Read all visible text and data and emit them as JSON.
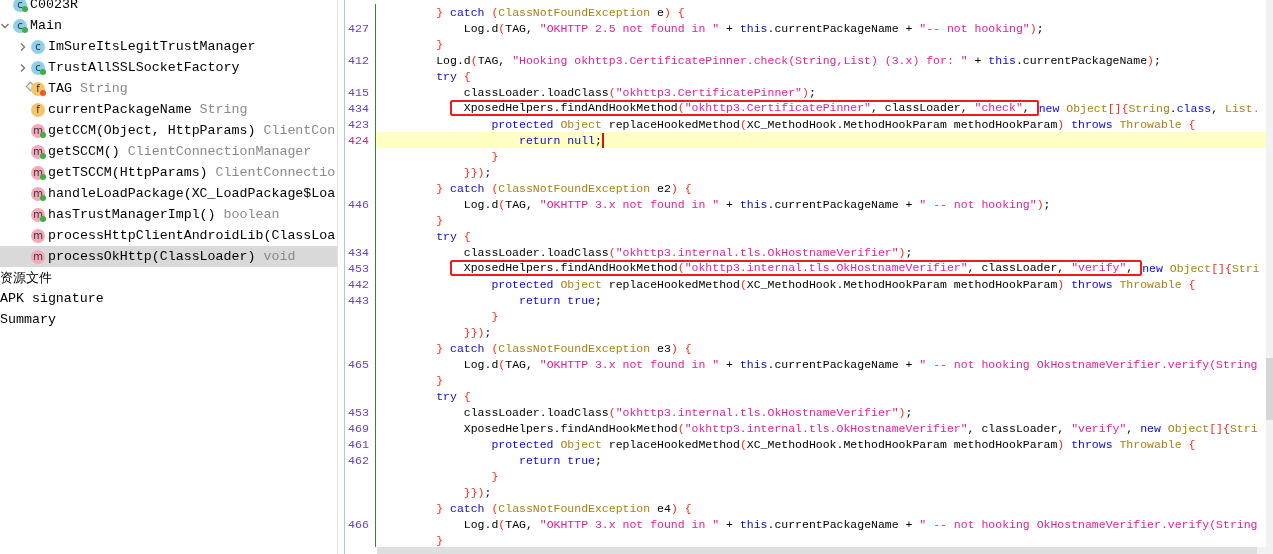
{
  "tree": {
    "items": [
      {
        "children": [
          {
            "label": "C0023R",
            "kind": "class",
            "icon": "c",
            "color": "#3cb043",
            "selected": false
          },
          {
            "label": "Main",
            "kind": "class",
            "icon": "c",
            "color": "#3cb043",
            "expanded": true,
            "selected": false,
            "children": [
              {
                "label": "ImSureItsLegitTrustManager",
                "kind": "class",
                "icon": "c",
                "expanded": false,
                "selected": false
              },
              {
                "label": "TrustAllSSLSocketFactory",
                "kind": "class",
                "icon": "c",
                "color": "#3cb043",
                "expanded": false,
                "selected": false
              },
              {
                "label": "TAG",
                "type": "String",
                "kind": "field",
                "icon": "f",
                "color": "#f05a24",
                "static": true,
                "selected": false
              },
              {
                "label": "currentPackageName",
                "type": "String",
                "kind": "field",
                "icon": "f",
                "selected": false
              },
              {
                "label": "getCCM(Object, HttpParams)",
                "type": "ClientCon",
                "kind": "method",
                "icon": "m",
                "color": "#3cb043",
                "selected": false
              },
              {
                "label": "getSCCM()",
                "type": "ClientConnectionManager",
                "kind": "method",
                "icon": "m",
                "color": "#3cb043",
                "selected": false
              },
              {
                "label": "getTSCCM(HttpParams)",
                "type": "ClientConnectio",
                "kind": "method",
                "icon": "m",
                "color": "#3cb043",
                "selected": false
              },
              {
                "label": "handleLoadPackage(XC_LoadPackage$Loa",
                "kind": "method",
                "icon": "m",
                "color": "#3cb043",
                "selected": false
              },
              {
                "label": "hasTrustManagerImpl()",
                "type": "boolean",
                "kind": "method",
                "icon": "m",
                "color": "#3cb043",
                "selected": false
              },
              {
                "label": "processHttpClientAndroidLib(ClassLoa",
                "kind": "method",
                "icon": "m",
                "selected": false
              },
              {
                "label": "processOkHttp(ClassLoader)",
                "type": "void",
                "kind": "method",
                "icon": "m",
                "selected": true
              }
            ]
          }
        ]
      },
      {
        "label": "资源文件",
        "selected": false
      },
      {
        "label": "APK signature",
        "selected": false
      },
      {
        "label": "Summary",
        "selected": false
      }
    ]
  },
  "editor": {
    "lines": [
      {
        "segments": [
          {
            "kind": "b",
            "text": "        }"
          },
          {
            "kind": "k",
            "text": " catch "
          },
          {
            "kind": "b",
            "text": "("
          },
          {
            "kind": "t",
            "text": "ClassNotFoundException"
          },
          {
            "kind": "p",
            "text": " e"
          },
          {
            "kind": "b",
            "text": ") {"
          }
        ]
      },
      {
        "number": "427",
        "segments": [
          {
            "kind": "p",
            "text": "            Log.d"
          },
          {
            "kind": "b",
            "text": "("
          },
          {
            "kind": "p",
            "text": "TAG, "
          },
          {
            "kind": "s",
            "text": "\"OKHTTP 2.5 not found in \""
          },
          {
            "kind": "p",
            "text": " + "
          },
          {
            "kind": "k",
            "text": "this"
          },
          {
            "kind": "p",
            "text": ".currentPackageName + "
          },
          {
            "kind": "s",
            "text": "\"-- not hooking\""
          },
          {
            "kind": "b",
            "text": ")"
          },
          {
            "kind": "p",
            "text": ";"
          }
        ]
      },
      {
        "segments": [
          {
            "kind": "b",
            "text": "        }"
          }
        ]
      },
      {
        "number": "412",
        "segments": [
          {
            "kind": "p",
            "text": "        Log.d"
          },
          {
            "kind": "b",
            "text": "("
          },
          {
            "kind": "p",
            "text": "TAG, "
          },
          {
            "kind": "s",
            "text": "\"Hooking okhttp3.CertificatePinner.check(String,List) (3.x) for: \""
          },
          {
            "kind": "p",
            "text": " + "
          },
          {
            "kind": "k",
            "text": "this"
          },
          {
            "kind": "p",
            "text": ".currentPackageName"
          },
          {
            "kind": "b",
            "text": ")"
          },
          {
            "kind": "p",
            "text": ";"
          }
        ]
      },
      {
        "segments": [
          {
            "kind": "k",
            "text": "        try "
          },
          {
            "kind": "b",
            "text": "{"
          }
        ]
      },
      {
        "number": "415",
        "segments": [
          {
            "kind": "p",
            "text": "            classLoader.loadClass"
          },
          {
            "kind": "b",
            "text": "("
          },
          {
            "kind": "s",
            "text": "\"okhttp3.CertificatePinner\""
          },
          {
            "kind": "b",
            "text": ")"
          },
          {
            "kind": "p",
            "text": ";"
          }
        ]
      },
      {
        "number": "434",
        "boxed": [
          {
            "kind": "p",
            "text": "            XposedHelpers.findAndHookMethod"
          },
          {
            "kind": "b",
            "text": "("
          },
          {
            "kind": "s",
            "text": "\"okhttp3.CertificatePinner\""
          },
          {
            "kind": "p",
            "text": ", classLoader, "
          },
          {
            "kind": "s",
            "text": "\"check\""
          },
          {
            "kind": "p",
            "text": ", "
          }
        ],
        "segments": [
          {
            "kind": "k",
            "text": "new "
          },
          {
            "kind": "t",
            "text": "Object"
          },
          {
            "kind": "b",
            "text": "[]{"
          },
          {
            "kind": "t",
            "text": "String"
          },
          {
            "kind": "p",
            "text": "."
          },
          {
            "kind": "k",
            "text": "class"
          },
          {
            "kind": "p",
            "text": ", "
          },
          {
            "kind": "t",
            "text": "List."
          }
        ]
      },
      {
        "number": "423",
        "segments": [
          {
            "kind": "k",
            "text": "                protected "
          },
          {
            "kind": "t",
            "text": "Object"
          },
          {
            "kind": "p",
            "text": " replaceHookedMethod"
          },
          {
            "kind": "b",
            "text": "("
          },
          {
            "kind": "p",
            "text": "XC_MethodHook.MethodHookParam methodHookParam"
          },
          {
            "kind": "b",
            "text": ")"
          },
          {
            "kind": "k",
            "text": " throws "
          },
          {
            "kind": "t",
            "text": "Throwable"
          },
          {
            "kind": "b",
            "text": " {"
          }
        ]
      },
      {
        "number": "424",
        "current": true,
        "segments": [
          {
            "kind": "k",
            "text": "                    return null"
          },
          {
            "kind": "p",
            "text": ";"
          }
        ]
      },
      {
        "segments": [
          {
            "kind": "b",
            "text": "                }"
          }
        ]
      },
      {
        "segments": [
          {
            "kind": "b",
            "text": "            }})"
          },
          {
            "kind": "p",
            "text": ";"
          }
        ]
      },
      {
        "segments": [
          {
            "kind": "b",
            "text": "        }"
          },
          {
            "kind": "k",
            "text": " catch "
          },
          {
            "kind": "b",
            "text": "("
          },
          {
            "kind": "t",
            "text": "ClassNotFoundException"
          },
          {
            "kind": "p",
            "text": " e2"
          },
          {
            "kind": "b",
            "text": ") {"
          }
        ]
      },
      {
        "number": "446",
        "segments": [
          {
            "kind": "p",
            "text": "            Log.d"
          },
          {
            "kind": "b",
            "text": "("
          },
          {
            "kind": "p",
            "text": "TAG, "
          },
          {
            "kind": "s",
            "text": "\"OKHTTP 3.x not found in \""
          },
          {
            "kind": "p",
            "text": " + "
          },
          {
            "kind": "k",
            "text": "this"
          },
          {
            "kind": "p",
            "text": ".currentPackageName + "
          },
          {
            "kind": "s",
            "text": "\" -- not hooking\""
          },
          {
            "kind": "b",
            "text": ")"
          },
          {
            "kind": "p",
            "text": ";"
          }
        ]
      },
      {
        "segments": [
          {
            "kind": "b",
            "text": "        }"
          }
        ]
      },
      {
        "segments": [
          {
            "kind": "k",
            "text": "        try "
          },
          {
            "kind": "b",
            "text": "{"
          }
        ]
      },
      {
        "number": "434",
        "segments": [
          {
            "kind": "p",
            "text": "            classLoader.loadClass"
          },
          {
            "kind": "b",
            "text": "("
          },
          {
            "kind": "s",
            "text": "\"okhttp3.internal.tls.OkHostnameVerifier\""
          },
          {
            "kind": "b",
            "text": ")"
          },
          {
            "kind": "p",
            "text": ";"
          }
        ]
      },
      {
        "number": "453",
        "boxed": [
          {
            "kind": "p",
            "text": "            XposedHelpers.findAndHookMethod"
          },
          {
            "kind": "b",
            "text": "("
          },
          {
            "kind": "s",
            "text": "\"okhttp3.internal.tls.OkHostnameVerifier\""
          },
          {
            "kind": "p",
            "text": ", classLoader, "
          },
          {
            "kind": "s",
            "text": "\"verify\""
          },
          {
            "kind": "p",
            "text": ", "
          }
        ],
        "segments": [
          {
            "kind": "k",
            "text": "new "
          },
          {
            "kind": "t",
            "text": "Object"
          },
          {
            "kind": "b",
            "text": "[]{"
          },
          {
            "kind": "t",
            "text": "Stri"
          }
        ]
      },
      {
        "number": "442",
        "segments": [
          {
            "kind": "k",
            "text": "                protected "
          },
          {
            "kind": "t",
            "text": "Object"
          },
          {
            "kind": "p",
            "text": " replaceHookedMethod"
          },
          {
            "kind": "b",
            "text": "("
          },
          {
            "kind": "p",
            "text": "XC_MethodHook.MethodHookParam methodHookParam"
          },
          {
            "kind": "b",
            "text": ")"
          },
          {
            "kind": "k",
            "text": " throws "
          },
          {
            "kind": "t",
            "text": "Throwable"
          },
          {
            "kind": "b",
            "text": " {"
          }
        ]
      },
      {
        "number": "443",
        "segments": [
          {
            "kind": "k",
            "text": "                    return true"
          },
          {
            "kind": "p",
            "text": ";"
          }
        ]
      },
      {
        "segments": [
          {
            "kind": "b",
            "text": "                }"
          }
        ]
      },
      {
        "segments": [
          {
            "kind": "b",
            "text": "            }})"
          },
          {
            "kind": "p",
            "text": ";"
          }
        ]
      },
      {
        "segments": [
          {
            "kind": "b",
            "text": "        }"
          },
          {
            "kind": "k",
            "text": " catch "
          },
          {
            "kind": "b",
            "text": "("
          },
          {
            "kind": "t",
            "text": "ClassNotFoundException"
          },
          {
            "kind": "p",
            "text": " e3"
          },
          {
            "kind": "b",
            "text": ") {"
          }
        ]
      },
      {
        "number": "465",
        "segments": [
          {
            "kind": "p",
            "text": "            Log.d"
          },
          {
            "kind": "b",
            "text": "("
          },
          {
            "kind": "p",
            "text": "TAG, "
          },
          {
            "kind": "s",
            "text": "\"OKHTTP 3.x not found in \""
          },
          {
            "kind": "p",
            "text": " + "
          },
          {
            "kind": "k",
            "text": "this"
          },
          {
            "kind": "p",
            "text": ".currentPackageName + "
          },
          {
            "kind": "s",
            "text": "\" -- not hooking OkHostnameVerifier.verify(String"
          }
        ]
      },
      {
        "segments": [
          {
            "kind": "b",
            "text": "        }"
          }
        ]
      },
      {
        "segments": [
          {
            "kind": "k",
            "text": "        try "
          },
          {
            "kind": "b",
            "text": "{"
          }
        ]
      },
      {
        "number": "453",
        "segments": [
          {
            "kind": "p",
            "text": "            classLoader.loadClass"
          },
          {
            "kind": "b",
            "text": "("
          },
          {
            "kind": "s",
            "text": "\"okhttp3.internal.tls.OkHostnameVerifier\""
          },
          {
            "kind": "b",
            "text": ")"
          },
          {
            "kind": "p",
            "text": ";"
          }
        ]
      },
      {
        "number": "469",
        "segments": [
          {
            "kind": "p",
            "text": "            XposedHelpers.findAndHookMethod"
          },
          {
            "kind": "b",
            "text": "("
          },
          {
            "kind": "s",
            "text": "\"okhttp3.internal.tls.OkHostnameVerifier\""
          },
          {
            "kind": "p",
            "text": ", classLoader, "
          },
          {
            "kind": "s",
            "text": "\"verify\""
          },
          {
            "kind": "p",
            "text": ", "
          },
          {
            "kind": "k",
            "text": "new "
          },
          {
            "kind": "t",
            "text": "Object"
          },
          {
            "kind": "b",
            "text": "[]{"
          },
          {
            "kind": "t",
            "text": "Stri"
          }
        ]
      },
      {
        "number": "461",
        "segments": [
          {
            "kind": "k",
            "text": "                protected "
          },
          {
            "kind": "t",
            "text": "Object"
          },
          {
            "kind": "p",
            "text": " replaceHookedMethod"
          },
          {
            "kind": "b",
            "text": "("
          },
          {
            "kind": "p",
            "text": "XC_MethodHook.MethodHookParam methodHookParam"
          },
          {
            "kind": "b",
            "text": ")"
          },
          {
            "kind": "k",
            "text": " throws "
          },
          {
            "kind": "t",
            "text": "Throwable"
          },
          {
            "kind": "b",
            "text": " {"
          }
        ]
      },
      {
        "number": "462",
        "segments": [
          {
            "kind": "k",
            "text": "                    return true"
          },
          {
            "kind": "p",
            "text": ";"
          }
        ]
      },
      {
        "segments": [
          {
            "kind": "b",
            "text": "                }"
          }
        ]
      },
      {
        "segments": [
          {
            "kind": "b",
            "text": "            }})"
          },
          {
            "kind": "p",
            "text": ";"
          }
        ]
      },
      {
        "segments": [
          {
            "kind": "b",
            "text": "        }"
          },
          {
            "kind": "k",
            "text": " catch "
          },
          {
            "kind": "b",
            "text": "("
          },
          {
            "kind": "t",
            "text": "ClassNotFoundException"
          },
          {
            "kind": "p",
            "text": " e4"
          },
          {
            "kind": "b",
            "text": ") {"
          }
        ]
      },
      {
        "number": "466",
        "segments": [
          {
            "kind": "p",
            "text": "            Log.d"
          },
          {
            "kind": "b",
            "text": "("
          },
          {
            "kind": "p",
            "text": "TAG, "
          },
          {
            "kind": "s",
            "text": "\"OKHTTP 3.x not found in \""
          },
          {
            "kind": "p",
            "text": " + "
          },
          {
            "kind": "k",
            "text": "this"
          },
          {
            "kind": "p",
            "text": ".currentPackageName + "
          },
          {
            "kind": "s",
            "text": "\" -- not hooking OkHostnameVerifier.verify(String"
          }
        ]
      },
      {
        "segments": [
          {
            "kind": "b",
            "text": "        }"
          }
        ]
      }
    ]
  }
}
